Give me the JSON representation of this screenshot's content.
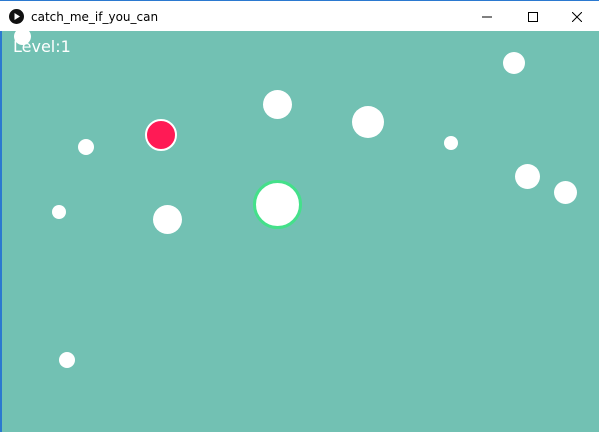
{
  "window": {
    "title": "catch_me_if_you_can",
    "icons": {
      "app": "processing-play-icon",
      "minimize": "minimize-icon",
      "maximize": "maximize-icon",
      "close": "close-icon"
    }
  },
  "game": {
    "level_label": "Level:1",
    "colors": {
      "background": "#72c1b3",
      "ball": "#ffffff",
      "target": "#ff1a55",
      "player_outline": "#44e08a",
      "text": "#ffffff"
    }
  }
}
